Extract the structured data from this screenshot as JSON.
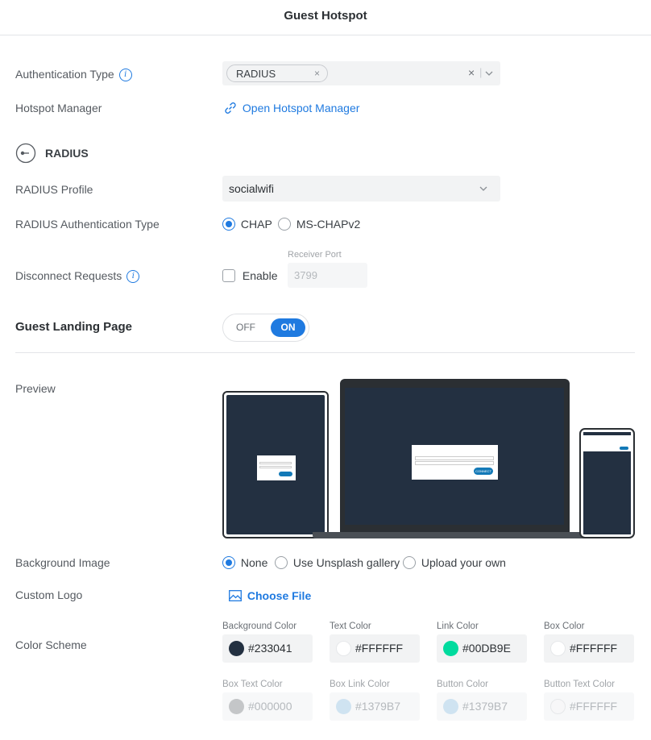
{
  "header": {
    "title": "Guest Hotspot"
  },
  "auth": {
    "label": "Authentication Type",
    "chip": "RADIUS",
    "chip_remove": "×",
    "clear": "×",
    "separator": "|"
  },
  "hotspot_manager": {
    "label": "Hotspot Manager",
    "link": "Open Hotspot Manager"
  },
  "radius_section": {
    "title": "RADIUS"
  },
  "radius_profile": {
    "label": "RADIUS Profile",
    "value": "socialwifi"
  },
  "radius_auth_type": {
    "label": "RADIUS Authentication Type",
    "options": [
      {
        "label": "CHAP",
        "selected": true
      },
      {
        "label": "MS-CHAPv2",
        "selected": false
      }
    ]
  },
  "disconnect": {
    "label": "Disconnect Requests",
    "enable_label": "Enable",
    "enabled": false,
    "port_label": "Receiver Port",
    "port_value": "3799"
  },
  "landing": {
    "title": "Guest Landing Page",
    "off_label": "OFF",
    "on_label": "ON",
    "state": "on"
  },
  "preview": {
    "label": "Preview",
    "button_text": "CONNECT"
  },
  "background_image": {
    "label": "Background Image",
    "options": [
      {
        "label": "None",
        "selected": true
      },
      {
        "label": "Use Unsplash gallery",
        "selected": false
      },
      {
        "label": "Upload your own",
        "selected": false
      }
    ]
  },
  "custom_logo": {
    "label": "Custom Logo",
    "button": "Choose File"
  },
  "color_scheme": {
    "label": "Color Scheme",
    "fields": [
      {
        "label": "Background Color",
        "value": "#233041",
        "swatch": "#233041",
        "disabled": false
      },
      {
        "label": "Text Color",
        "value": "#FFFFFF",
        "swatch": "#FFFFFF",
        "disabled": false
      },
      {
        "label": "Link Color",
        "value": "#00DB9E",
        "swatch": "#00DB9E",
        "disabled": false
      },
      {
        "label": "Box Color",
        "value": "#FFFFFF",
        "swatch": "#FFFFFF",
        "disabled": false
      },
      {
        "label": "Box Text Color",
        "value": "#000000",
        "swatch": "#c4c6c8",
        "disabled": true
      },
      {
        "label": "Box Link Color",
        "value": "#1379B7",
        "swatch": "#cfe3f1",
        "disabled": true
      },
      {
        "label": "Button Color",
        "value": "#1379B7",
        "swatch": "#cfe3f1",
        "disabled": true
      },
      {
        "label": "Button Text Color",
        "value": "#FFFFFF",
        "swatch": "#f7f7f8",
        "disabled": true
      }
    ]
  },
  "colors": {
    "accent": "#1f7ae0",
    "screen": "#233041"
  }
}
